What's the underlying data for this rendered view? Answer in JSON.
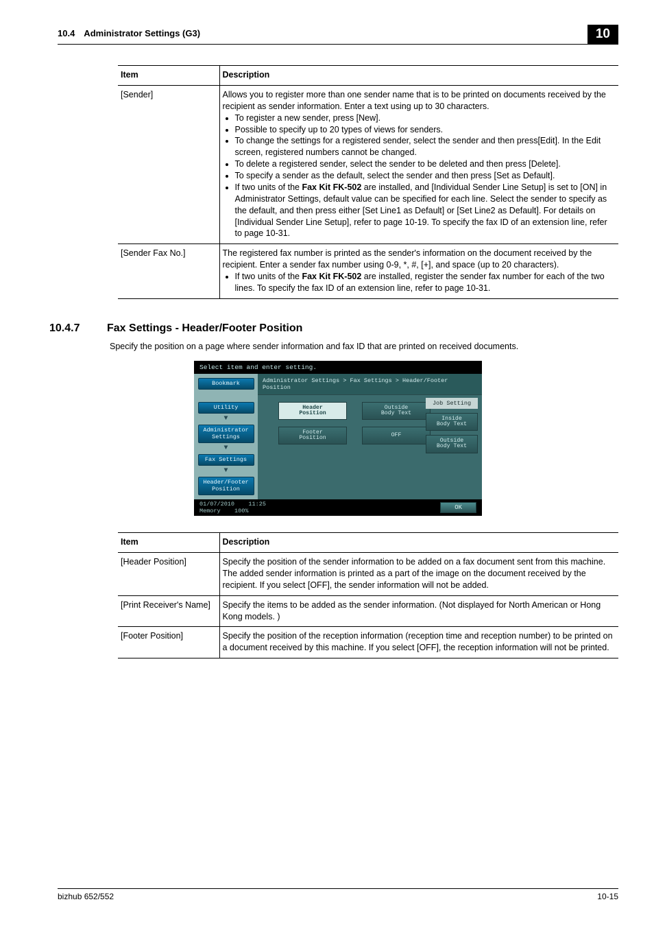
{
  "runhead": {
    "left": "10.4 Administrator Settings (G3)",
    "chapter": "10"
  },
  "table1": {
    "hdr": {
      "item": "Item",
      "desc": "Description"
    },
    "rows": [
      {
        "item": "[Sender]",
        "intro": "Allows you to register more than one sender name that is to be printed on documents received by the recipient as sender information. Enter a text using up to 30 characters.",
        "b1": "To register a new sender, press [New].",
        "b2": "Possible to specify up to 20 types of views for senders.",
        "b3": "To change the settings for a registered sender, select the sender and then press[Edit]. In the Edit screen, registered numbers cannot be changed.",
        "b4": "To delete a registered sender, select the sender to be deleted and then press [Delete].",
        "b5": "To specify a sender as the default, select the sender and then press [Set as Default].",
        "b6a": "If two units of the ",
        "b6b": "Fax Kit FK-502",
        "b6c": " are installed, and [Individual Sender Line Setup] is set to [ON] in Administrator Settings, default value can be specified for each line. Select the sender to specify as the default, and then press either [Set Line1 as Default] or [Set Line2 as Default]. For details on [Individual Sender Line Setup], refer to page 10-19. To specify the fax ID of an extension line, refer to page 10-31."
      },
      {
        "item": "[Sender Fax No.]",
        "intro": "The registered fax number is printed as the sender's information on the document received by the recipient. Enter a sender fax number using 0-9, *, #, [+], and space (up to 20 characters).",
        "b1a": "If two units of the ",
        "b1b": "Fax Kit FK-502",
        "b1c": " are installed, register the sender fax number for each of the two lines. To specify the fax ID of an extension line, refer to page 10-31."
      }
    ]
  },
  "section": {
    "num": "10.4.7",
    "title": "Fax Settings - Header/Footer Position",
    "intro": "Specify the position on a page where sender information and fax ID that are printed on received documents."
  },
  "cap": {
    "title": "Select item and enter setting.",
    "bookmark": "Bookmark",
    "side": [
      "Utility",
      "Administrator Settings",
      "Fax Settings",
      "Header/Footer Position"
    ],
    "breadcrumb": "Administrator Settings  >  Fax Settings  >  Header/Footer Position",
    "btns": {
      "headerpos": "Header\nPosition",
      "outside1": "Outside\nBody Text",
      "footerpos": "Footer\nPosition",
      "off": "OFF"
    },
    "right": {
      "jobsetting": "Job Setting",
      "inside": "Inside\nBody Text",
      "outside": "Outside\nBody Text"
    },
    "status": {
      "date": "01/07/2010",
      "time": "11:25",
      "memlabel": "Memory",
      "mem": "100%",
      "ok": "OK"
    }
  },
  "table2": {
    "hdr": {
      "item": "Item",
      "desc": "Description"
    },
    "rows": [
      {
        "item": "[Header Position]",
        "desc": "Specify the position of the sender information to be added on a fax document sent from this machine. The added sender information is printed as a part of the image on the document received by the recipient. If you select [OFF], the sender information will not be added."
      },
      {
        "item": "[Print Receiver's Name]",
        "desc": "Specify the items to be added as the sender information. (Not displayed for North American or Hong Kong models. )"
      },
      {
        "item": "[Footer Position]",
        "desc": "Specify the position of the reception information (reception time and reception number) to be printed on a document received by this machine. If you select [OFF], the reception information will not be printed."
      }
    ]
  },
  "runfoot": {
    "left": "bizhub 652/552",
    "right": "10-15"
  }
}
